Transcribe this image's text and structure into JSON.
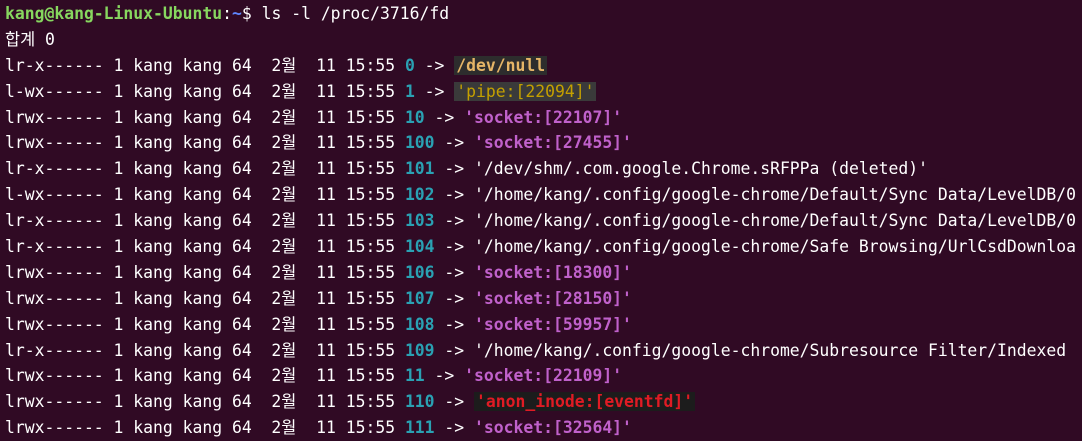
{
  "terminal": {
    "prompt_user": "kang@kang-Linux-Ubuntu",
    "prompt_sep": ":",
    "prompt_path": "~",
    "prompt_symbol": "$ ",
    "command": "ls -l /proc/3716/fd",
    "total_line": "합계 0",
    "arrow": " -> ",
    "colors": {
      "background": "#300a24",
      "user": "#87d75f",
      "fd_number": "#2aa1b3",
      "socket": "#c061cb",
      "pipe": "#c4a000",
      "anon_inode": "#e01b24",
      "dev": "#e5b567"
    },
    "entries": [
      {
        "meta": "lr-x------ 1 kang kang 64  2월  11 15:55 ",
        "fd": "0",
        "target": "/dev/null",
        "kind": "dev"
      },
      {
        "meta": "l-wx------ 1 kang kang 64  2월  11 15:55 ",
        "fd": "1",
        "target": "'pipe:[22094]'",
        "kind": "pipe"
      },
      {
        "meta": "lrwx------ 1 kang kang 64  2월  11 15:55 ",
        "fd": "10",
        "target": "'socket:[22107]'",
        "kind": "socket"
      },
      {
        "meta": "lrwx------ 1 kang kang 64  2월  11 15:55 ",
        "fd": "100",
        "target": "'socket:[27455]'",
        "kind": "socket"
      },
      {
        "meta": "lr-x------ 1 kang kang 64  2월  11 15:55 ",
        "fd": "101",
        "target": "'/dev/shm/.com.google.Chrome.sRFPPa (deleted)'",
        "kind": "file"
      },
      {
        "meta": "l-wx------ 1 kang kang 64  2월  11 15:55 ",
        "fd": "102",
        "target": "'/home/kang/.config/google-chrome/Default/Sync Data/LevelDB/0",
        "kind": "file"
      },
      {
        "meta": "lr-x------ 1 kang kang 64  2월  11 15:55 ",
        "fd": "103",
        "target": "'/home/kang/.config/google-chrome/Default/Sync Data/LevelDB/0",
        "kind": "file"
      },
      {
        "meta": "lr-x------ 1 kang kang 64  2월  11 15:55 ",
        "fd": "104",
        "target": "'/home/kang/.config/google-chrome/Safe Browsing/UrlCsdDownloa",
        "kind": "file"
      },
      {
        "meta": "lrwx------ 1 kang kang 64  2월  11 15:55 ",
        "fd": "106",
        "target": "'socket:[18300]'",
        "kind": "socket"
      },
      {
        "meta": "lrwx------ 1 kang kang 64  2월  11 15:55 ",
        "fd": "107",
        "target": "'socket:[28150]'",
        "kind": "socket"
      },
      {
        "meta": "lrwx------ 1 kang kang 64  2월  11 15:55 ",
        "fd": "108",
        "target": "'socket:[59957]'",
        "kind": "socket"
      },
      {
        "meta": "lr-x------ 1 kang kang 64  2월  11 15:55 ",
        "fd": "109",
        "target": "'/home/kang/.config/google-chrome/Subresource Filter/Indexed",
        "kind": "file"
      },
      {
        "meta": "lrwx------ 1 kang kang 64  2월  11 15:55 ",
        "fd": "11",
        "target": "'socket:[22109]'",
        "kind": "socket"
      },
      {
        "meta": "lrwx------ 1 kang kang 64  2월  11 15:55 ",
        "fd": "110",
        "target": "'anon_inode:[eventfd]'",
        "kind": "anon"
      },
      {
        "meta": "lrwx------ 1 kang kang 64  2월  11 15:55 ",
        "fd": "111",
        "target": "'socket:[32564]'",
        "kind": "socket"
      }
    ]
  }
}
